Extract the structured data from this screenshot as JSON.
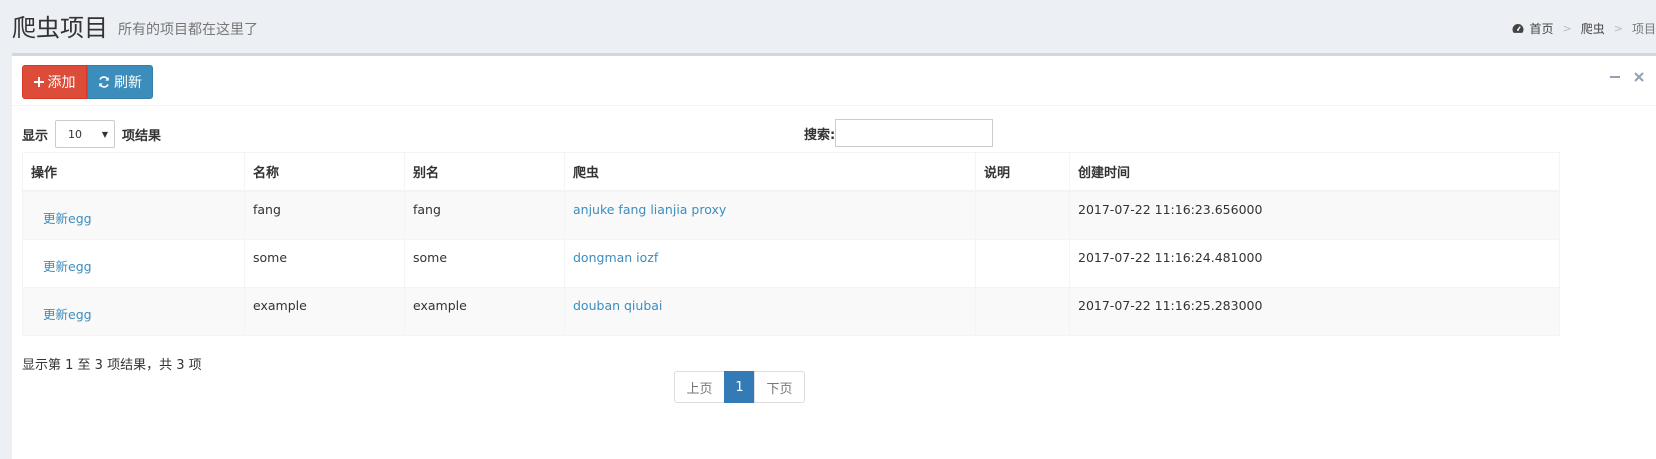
{
  "header": {
    "title": "爬虫项目",
    "subtitle": "所有的项目都在这里了"
  },
  "breadcrumb": {
    "items": [
      "首页",
      "爬虫",
      "项目"
    ],
    "icon": "dashboard-icon"
  },
  "toolbar": {
    "add_label": "添加",
    "refresh_label": "刷新",
    "add_icon": "plus-icon",
    "refresh_icon": "refresh-icon"
  },
  "box_tools": {
    "collapse_icon": "minus-icon",
    "remove_icon": "times-icon"
  },
  "length": {
    "prefix": "显示",
    "value": "10",
    "suffix": "项结果"
  },
  "search": {
    "label": "搜索:",
    "value": ""
  },
  "table": {
    "columns": [
      "操作",
      "名称",
      "别名",
      "爬虫",
      "说明",
      "创建时间"
    ],
    "rows": [
      {
        "op": "更新egg",
        "name": "fang",
        "alias": "fang",
        "spiders": "anjuke fang lianjia proxy",
        "desc": "",
        "created": "2017-07-22 11:16:23.656000"
      },
      {
        "op": "更新egg",
        "name": "some",
        "alias": "some",
        "spiders": "dongman iozf",
        "desc": "",
        "created": "2017-07-22 11:16:24.481000"
      },
      {
        "op": "更新egg",
        "name": "example",
        "alias": "example",
        "spiders": "douban qiubai",
        "desc": "",
        "created": "2017-07-22 11:16:25.283000"
      }
    ]
  },
  "info": "显示第 1 至 3 项结果，共 3 项",
  "pagination": {
    "prev": "上页",
    "current": "1",
    "next": "下页"
  },
  "colors": {
    "danger": "#dd4b39",
    "primary": "#3c8dbc",
    "page_active": "#337ab7"
  }
}
